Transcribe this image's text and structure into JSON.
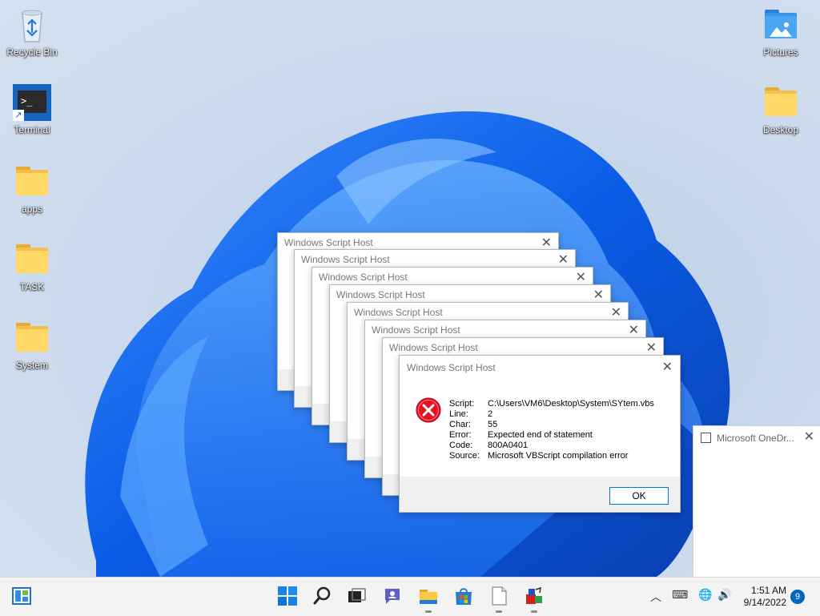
{
  "desktop": {
    "icons": [
      {
        "label": "Recycle Bin"
      },
      {
        "label": "Terminal"
      },
      {
        "label": "apps"
      },
      {
        "label": "TASK"
      },
      {
        "label": "System"
      },
      {
        "label": "Pictures"
      },
      {
        "label": "Desktop"
      }
    ]
  },
  "dialogs": {
    "stack_title": "Windows Script Host",
    "main": {
      "title": "Windows Script Host",
      "fields": [
        {
          "key": "Script:",
          "value": "C:\\Users\\VM6\\Desktop\\System\\SYtem.vbs"
        },
        {
          "key": "Line:",
          "value": "2"
        },
        {
          "key": "Char:",
          "value": "55"
        },
        {
          "key": "Error:",
          "value": "Expected end of statement"
        },
        {
          "key": "Code:",
          "value": "800A0401"
        },
        {
          "key": "Source:",
          "value": "Microsoft VBScript compilation error"
        }
      ],
      "ok_label": "OK"
    }
  },
  "onedrive": {
    "title": "Microsoft OneDr..."
  },
  "taskbar": {
    "clock_time": "1:51 AM",
    "clock_date": "9/14/2022",
    "notification_count": "9"
  },
  "colors": {
    "accent": "#0078d4",
    "error": "#e81123"
  }
}
